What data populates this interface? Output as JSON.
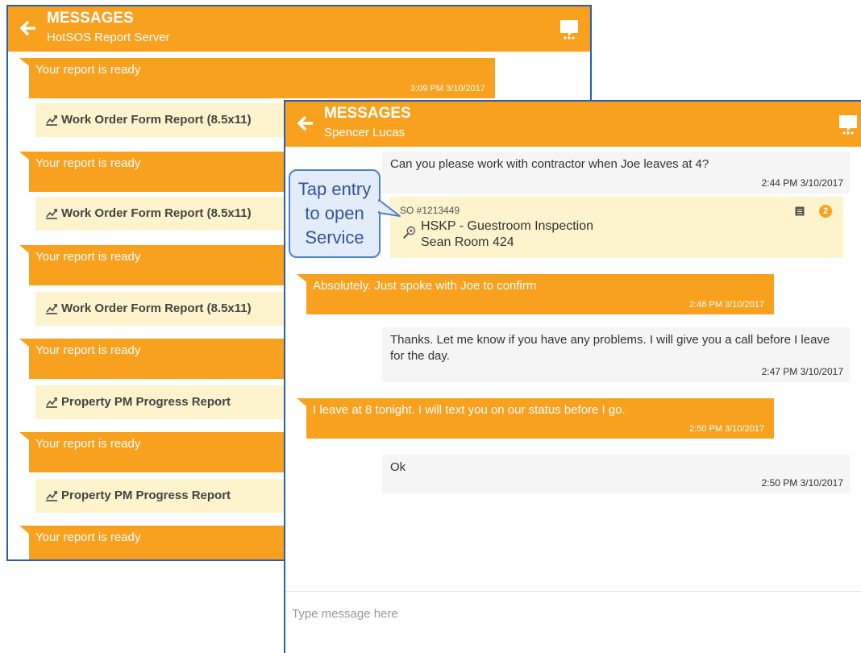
{
  "colors": {
    "accent": "#f8a11f",
    "report_bg": "#fdf3cc",
    "frame_border": "#2a5db0",
    "callout_text": "#2f5597"
  },
  "back_screen": {
    "header": {
      "title": "MESSAGES",
      "subtitle": "HotSOS Report Server"
    },
    "items": [
      {
        "message": "Your report is ready",
        "time": "3:09 PM 3/10/2017",
        "report": "Work Order Form Report (8.5x11)"
      },
      {
        "message": "Your report is ready",
        "report": "Work Order Form Report (8.5x11)"
      },
      {
        "message": "Your report is ready",
        "report": "Work Order Form Report (8.5x11)"
      },
      {
        "message": "Your report is ready",
        "report": "Property PM Progress Report"
      },
      {
        "message": "Your report is ready",
        "report": "Property PM Progress Report"
      },
      {
        "message": "Your report is ready"
      }
    ]
  },
  "front_screen": {
    "header": {
      "title": "MESSAGES",
      "subtitle": "Spencer Lucas"
    },
    "messages": [
      {
        "text": "Can you please work with contractor when Joe leaves at 4?",
        "time": "2:44 PM 3/10/2017"
      },
      {
        "text": "Absolutely. Just spoke with Joe to confirm",
        "time": "2:46 PM 3/10/2017"
      },
      {
        "text": "Thanks. Let me know if you have any problems. I will give you a call before I leave for the day.",
        "time": "2:47 PM 3/10/2017"
      },
      {
        "text": "I leave at 8 tonight. I will text you on our status before I go.",
        "time": "2:50 PM 3/10/2017"
      },
      {
        "text": "Ok",
        "time": "2:50 PM 3/10/2017"
      }
    ],
    "service_card": {
      "number": "SO #1213449",
      "title": "HSKP - Guestroom Inspection",
      "location": "Sean Room 424",
      "badge": "2"
    },
    "composer": {
      "placeholder": "Type message here"
    }
  },
  "callout": {
    "line1": "Tap entry",
    "line2": "to open",
    "line3": "Service"
  }
}
